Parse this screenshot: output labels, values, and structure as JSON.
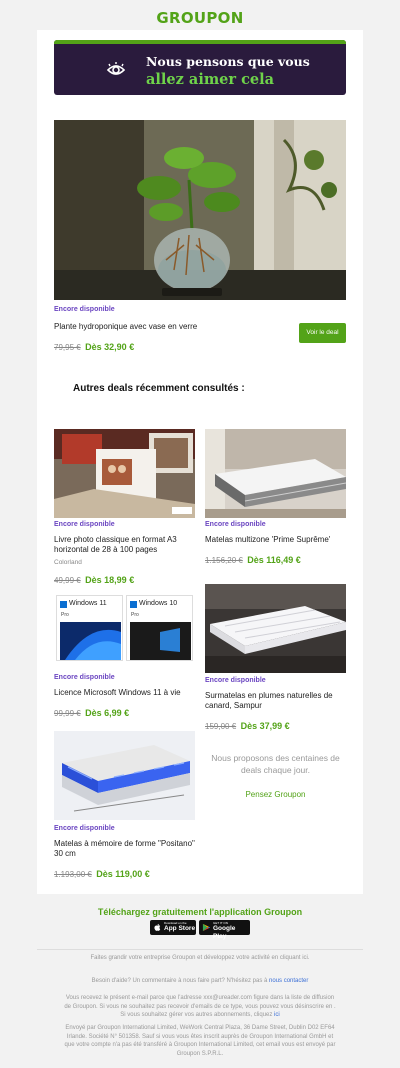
{
  "header": {
    "logo": "GROUPON"
  },
  "banner": {
    "line1": "Nous pensons que vous",
    "line2": "allez aimer cela",
    "icon": "eye-icon",
    "accent": "#53a318",
    "background": "#2a1b3d"
  },
  "featured": {
    "availability": "Encore disponible",
    "title": "Plante hydroponique avec vase en verre",
    "old_price": "79,95 €",
    "new_price": "Dès 32,90 €",
    "cta": "Voir le deal"
  },
  "section_title": "Autres deals récemment consultés :",
  "deals": [
    {
      "availability": "Encore disponible",
      "title": "Livre photo classique en format A3 horizontal de 28 à 100 pages",
      "brand": "Colorland",
      "old_price": "49,99 €",
      "new_price": "Dès 18,99 €"
    },
    {
      "availability": "Encore disponible",
      "title": "Matelas multizone 'Prime Suprême'",
      "old_price": "1.156,20 €",
      "new_price": "Dès 116,49 €"
    },
    {
      "availability": "Encore disponible",
      "title": "Licence Microsoft Windows 11 à vie",
      "old_price": "99,99 €",
      "new_price": "Dès 6,99 €",
      "img_text1": "Windows 11",
      "img_text2": "Windows 10",
      "img_pro": "Pro"
    },
    {
      "availability": "Encore disponible",
      "title": "Surmatelas en plumes naturelles de canard, Sampur",
      "old_price": "159,00 €",
      "new_price": "Dès 37,99 €"
    },
    {
      "availability": "Encore disponible",
      "title": "Matelas à mémoire de forme \"Positano\" 30 cm",
      "old_price": "1.193,00 €",
      "new_price": "Dès 119,00 €"
    }
  ],
  "promo": {
    "text": "Nous proposons des centaines de deals chaque jour.",
    "link": "Pensez Groupon"
  },
  "app": {
    "title": "Téléchargez gratuitement l'application Groupon",
    "appstore_small": "Download on the",
    "appstore_large": "App Store",
    "googleplay_small": "GET IT ON",
    "googleplay_large": "Google Play"
  },
  "footer": {
    "line1": "Faites grandir votre entreprise Groupon et développez votre activité en cliquant ici.",
    "help_text": "Besoin d'aide? Un commentaire à nous faire part? N'hésitez pas à",
    "help_link": "nous contacter",
    "legal1": "Vous recevez le présent e-mail parce que l'adresse xxx@ureader.com figure dans la liste de diffusion de Groupon. Si vous ne souhaitez pas recevoir d'emails de ce type, vous pouvez vous désinscrire en . Si vous souhaitez gérer vos autres abonnements, cliquez",
    "legal1_link": "ici",
    "legal2": "Envoyé par Groupon International Limited, WeWork Central Plaza, 36 Dame Street, Dublin D02 EF64 Irlande. Société N° 501358. Sauf si vous vous êtes inscrit auprès de Groupon International GmbH et que votre compte n'a pas été transféré à Groupon International Limited, cet email vous est envoyé par Groupon S.P.R.L."
  }
}
